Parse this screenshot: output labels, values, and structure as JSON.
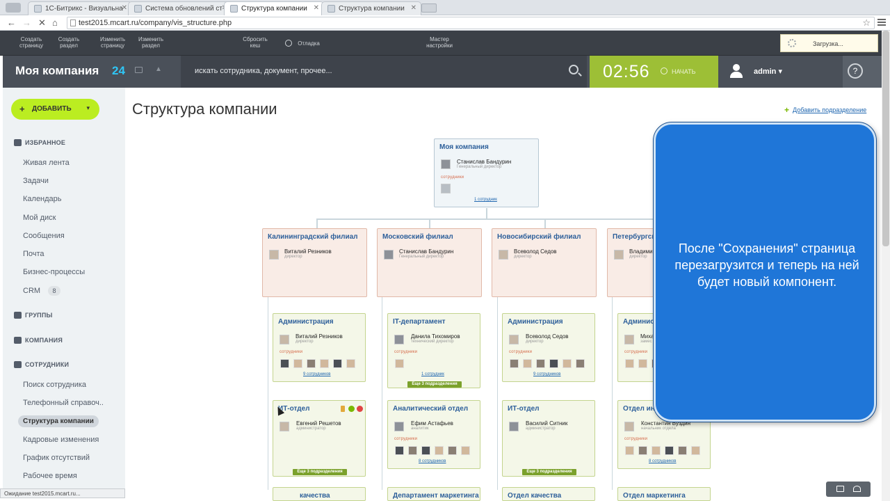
{
  "browser": {
    "tabs": [
      {
        "label": "1С-Битрикс - Визуальна",
        "active": false
      },
      {
        "label": "Система обновлений ст",
        "active": false
      },
      {
        "label": "Структура компании",
        "active": true
      },
      {
        "label": "Структура компании",
        "active": false
      }
    ],
    "url": "test2015.mcart.ru/company/vis_structure.php"
  },
  "admin_bar": {
    "buttons": [
      "Создать\nстраницу",
      "Создать\nраздел",
      "Изменить\nстраницу",
      "Изменить\nраздел",
      "Сбросить\nкеш",
      "Отладка",
      "Мастер\nнастройки"
    ],
    "loading": "Загрузка..."
  },
  "header": {
    "logo": "Моя компания",
    "logo_num": "24",
    "search_placeholder": "искать сотрудника, документ, прочее...",
    "timer_time": "02:56",
    "timer_start": "НАЧАТЬ",
    "user": "admin",
    "help": "?"
  },
  "sidebar": {
    "add_button": "ДОБАВИТЬ",
    "favorites": "ИЗБРАННОЕ",
    "items": [
      "Живая лента",
      "Задачи",
      "Календарь",
      "Мой диск",
      "Сообщения",
      "Почта",
      "Бизнес-процессы",
      "CRM"
    ],
    "crm_badge": "8",
    "groups": "ГРУППЫ",
    "company": "КОМПАНИЯ",
    "employees": "СОТРУДНИКИ",
    "employee_items": [
      "Поиск сотрудника",
      "Телефонный справоч..",
      "Структура компании",
      "Кадровые изменения",
      "График отсутствий",
      "Рабочее время"
    ]
  },
  "main": {
    "title": "Структура компании",
    "add_dept": "Добавить подразделение"
  },
  "structure": {
    "root": {
      "title": "Моя компания",
      "head": "Станислав Бандурин",
      "role": "Генеральный директор",
      "emp_label": "сотрудники",
      "emp_link": "1 сотрудник"
    },
    "branches": [
      {
        "title": "Калининградский филиал",
        "head": "Виталий Резников",
        "role": "директор"
      },
      {
        "title": "Московский филиал",
        "head": "Станислав Бандурин",
        "role": "Генеральный директор"
      },
      {
        "title": "Новосибирский филиал",
        "head": "Всеволод Седов",
        "role": "директор"
      },
      {
        "title": "Петербургск",
        "head": "Владимир",
        "role": "директор"
      }
    ],
    "depts": [
      {
        "title": "Администрация",
        "head": "Виталий Резников",
        "role": "директор",
        "emp_label": "сотрудники",
        "emp_link": "9 сотрудников",
        "badge": ""
      },
      {
        "title": "IT-департамент",
        "head": "Данила Тихомиров",
        "role": "технический директор",
        "emp_label": "сотрудники",
        "emp_link": "1 сотрудник",
        "badge": "Еще 3 подразделения"
      },
      {
        "title": "Администрация",
        "head": "Всеволод Седов",
        "role": "директор",
        "emp_label": "сотрудники",
        "emp_link": "9 сотрудников",
        "badge": ""
      },
      {
        "title": "Админис",
        "head": "Миха",
        "role": "замес",
        "emp_label": "сотрудники",
        "emp_link": "",
        "badge": ""
      },
      {
        "title": "ИТ-отдел",
        "head": "Евгений Решетов",
        "role": "администратор",
        "emp_label": "",
        "emp_link": "",
        "badge": "Еще 3 подразделения"
      },
      {
        "title": "Аналитический отдел",
        "head": "Ефим Астафьев",
        "role": "аналитик",
        "emp_label": "сотрудники",
        "emp_link": "8 сотрудников",
        "badge": ""
      },
      {
        "title": "ИТ-отдел",
        "head": "Василий Ситник",
        "role": "администратор",
        "emp_label": "",
        "emp_link": "",
        "badge": "Еще 3 подразделения"
      },
      {
        "title": "Отдел инф",
        "head": "Константин Вуздин",
        "role": "начальник отдела",
        "emp_label": "сотрудники",
        "emp_link": "8 сотрудников",
        "badge": ""
      }
    ],
    "bottom": [
      "качества",
      "Департамент маркетинга",
      "Отдел качества",
      "Отдел маркетинга"
    ]
  },
  "overlay": {
    "text": "После \"Сохранения\" страница перезагрузится и теперь на ней будет новый компонент."
  },
  "status": "Ожидание test2015.mcart.ru..."
}
